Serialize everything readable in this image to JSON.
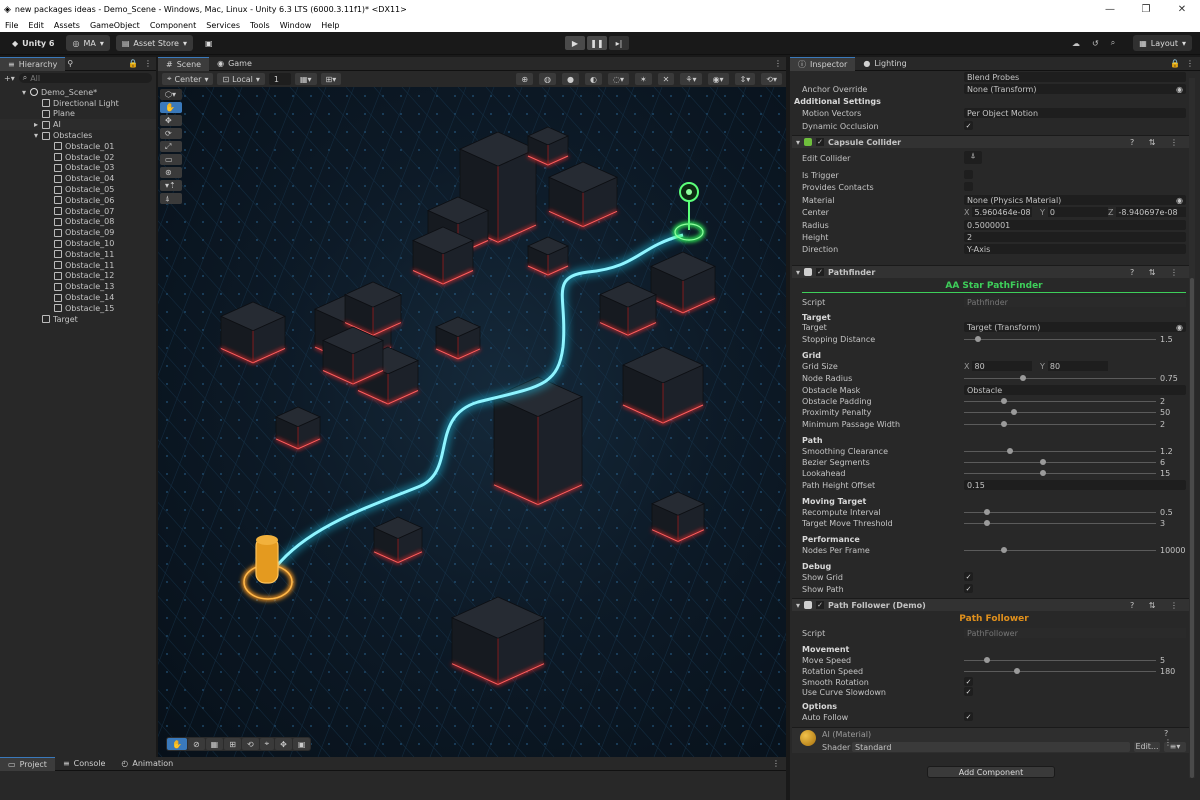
{
  "window": {
    "title": "new packages ideas - Demo_Scene - Windows, Mac, Linux - Unity 6.3 LTS (6000.3.11f1)* <DX11>"
  },
  "menu": [
    "File",
    "Edit",
    "Assets",
    "GameObject",
    "Component",
    "Services",
    "Tools",
    "Window",
    "Help"
  ],
  "toolbar": {
    "unity_label": "Unity 6",
    "account": "MA",
    "asset_store": "Asset Store",
    "layout": "Layout"
  },
  "hierarchy": {
    "tab": "Hierarchy",
    "search_placeholder": "All",
    "scene": "Demo_Scene*",
    "items": [
      "Directional Light",
      "Plane",
      "AI",
      "Obstacles",
      "Obstacle_01",
      "Obstacle_02",
      "Obstacle_03",
      "Obstacle_04",
      "Obstacle_05",
      "Obstacle_06",
      "Obstacle_07",
      "Obstacle_08",
      "Obstacle_09",
      "Obstacle_10",
      "Obstacle_11",
      "Obstacle_11",
      "Obstacle_12",
      "Obstacle_13",
      "Obstacle_14",
      "Obstacle_15",
      "Target"
    ]
  },
  "scene": {
    "tabs": [
      "Scene",
      "Game"
    ],
    "pivot": "Center",
    "space": "Local",
    "snap": "1"
  },
  "bottom_tabs": [
    "Project",
    "Console",
    "Animation"
  ],
  "inspector": {
    "tabs": [
      "Inspector",
      "Lighting"
    ],
    "blend_probes": "Blend Probes",
    "anchor_override": {
      "label": "Anchor Override",
      "value": "None (Transform)"
    },
    "additional_settings": "Additional Settings",
    "motion_vectors": {
      "label": "Motion Vectors",
      "value": "Per Object Motion"
    },
    "dynamic_occlusion": "Dynamic Occlusion",
    "capsule": {
      "title": "Capsule Collider",
      "edit_collider": "Edit Collider",
      "is_trigger": "Is Trigger",
      "provides_contacts": "Provides Contacts",
      "material": {
        "label": "Material",
        "value": "None (Physics Material)"
      },
      "center": {
        "label": "Center",
        "x": "5.960464e-08",
        "y": "0",
        "z": "-8.940697e-08"
      },
      "radius": {
        "label": "Radius",
        "value": "0.5000001"
      },
      "height": {
        "label": "Height",
        "value": "2"
      },
      "direction": {
        "label": "Direction",
        "value": "Y-Axis"
      }
    },
    "pathfinder": {
      "title": "Pathfinder",
      "banner": "AA Star PathFinder",
      "script": {
        "label": "Script",
        "value": "Pathfinder"
      },
      "target_section": "Target",
      "target": {
        "label": "Target",
        "value": "Target (Transform)"
      },
      "stopping_distance": {
        "label": "Stopping Distance",
        "value": "1.5",
        "fraction": 0.06
      },
      "grid_section": "Grid",
      "grid_size": {
        "label": "Grid Size",
        "x": "80",
        "y": "80"
      },
      "node_radius": {
        "label": "Node Radius",
        "value": "0.75",
        "fraction": 0.3
      },
      "obstacle_mask": {
        "label": "Obstacle Mask",
        "value": "Obstacle"
      },
      "obstacle_padding": {
        "label": "Obstacle Padding",
        "value": "2",
        "fraction": 0.2
      },
      "proximity_penalty": {
        "label": "Proximity Penalty",
        "value": "50",
        "fraction": 0.25
      },
      "min_passage": {
        "label": "Minimum Passage Width",
        "value": "2",
        "fraction": 0.2
      },
      "path_section": "Path",
      "smoothing": {
        "label": "Smoothing Clearance",
        "value": "1.2",
        "fraction": 0.23
      },
      "bezier": {
        "label": "Bezier Segments",
        "value": "6",
        "fraction": 0.41
      },
      "lookahead": {
        "label": "Lookahead",
        "value": "15",
        "fraction": 0.41
      },
      "path_height": {
        "label": "Path Height Offset",
        "value": "0.15"
      },
      "moving_section": "Moving Target",
      "recompute": {
        "label": "Recompute Interval",
        "value": "0.5",
        "fraction": 0.11
      },
      "move_threshold": {
        "label": "Target Move Threshold",
        "value": "3",
        "fraction": 0.11
      },
      "perf_section": "Performance",
      "nodes_per_frame": {
        "label": "Nodes Per Frame",
        "value": "10000",
        "fraction": 0.2
      },
      "debug_section": "Debug",
      "show_grid": "Show Grid",
      "show_path": "Show Path"
    },
    "follower": {
      "title": "Path Follower (Demo)",
      "banner": "Path Follower",
      "script": {
        "label": "Script",
        "value": "PathFollower"
      },
      "movement_section": "Movement",
      "move_speed": {
        "label": "Move Speed",
        "value": "5",
        "fraction": 0.11
      },
      "rotation_speed": {
        "label": "Rotation Speed",
        "value": "180",
        "fraction": 0.27
      },
      "smooth_rotation": "Smooth Rotation",
      "curve_slowdown": "Use Curve Slowdown",
      "options_section": "Options",
      "auto_follow": "Auto Follow"
    },
    "material": {
      "title": "AI (Material)",
      "shader_label": "Shader",
      "shader": "Standard",
      "edit": "Edit..."
    },
    "add_component": "Add Component"
  },
  "colors": {
    "accent": "#3a79bb",
    "pathfinder_green": "#3ecf5a",
    "follower_orange": "#e0901c",
    "path_cyan": "#22e6ff"
  }
}
